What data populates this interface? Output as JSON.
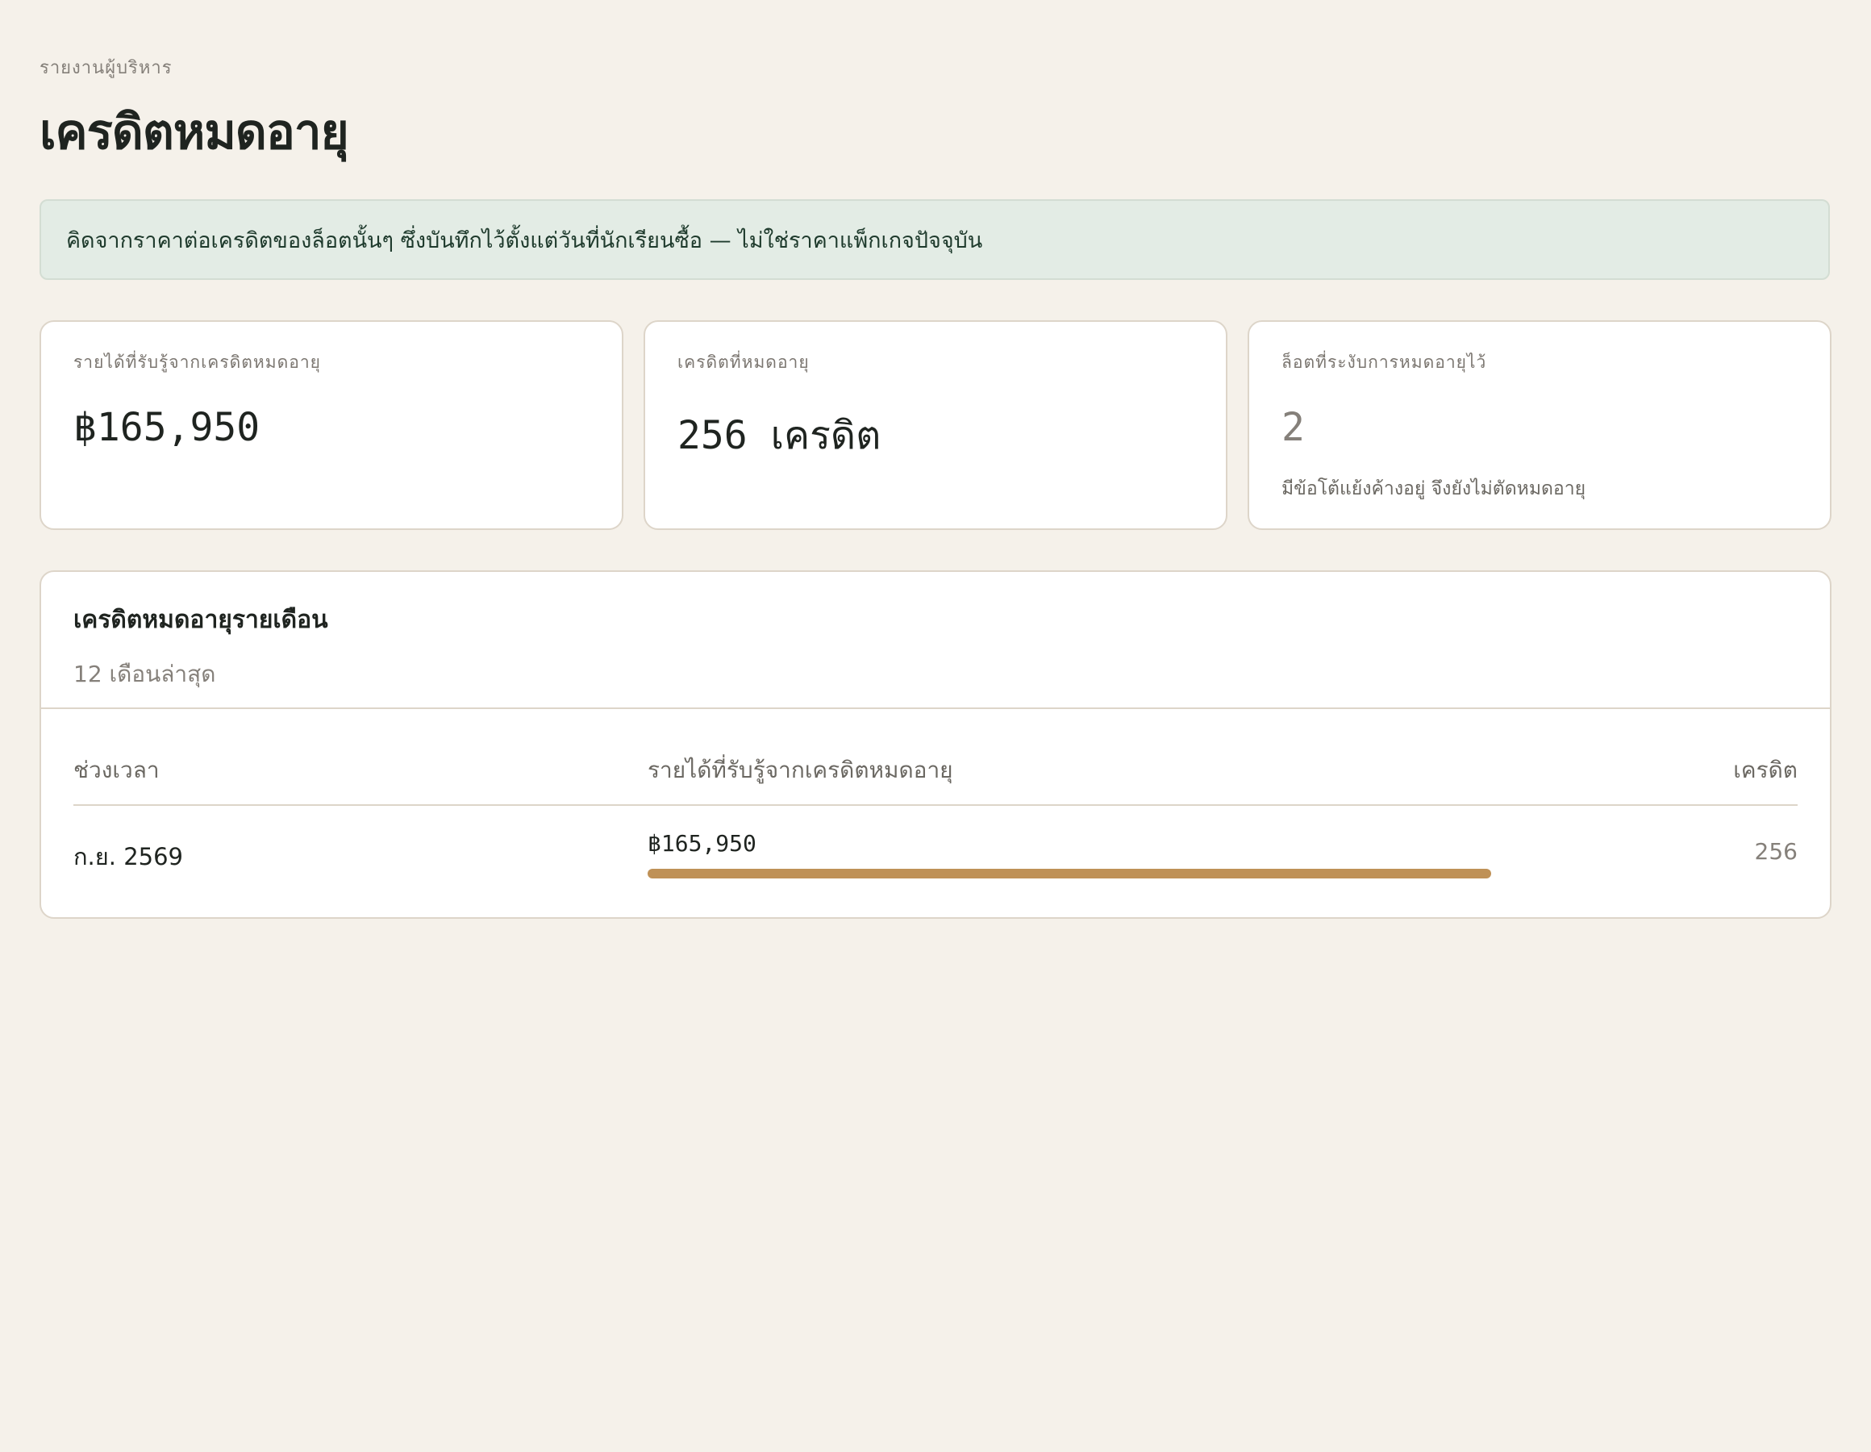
{
  "header": {
    "eyebrow": "รายงานผู้บริหาร",
    "title": "เครดิตหมดอายุ"
  },
  "notice": {
    "text": "คิดจากราคาต่อเครดิตของล็อตนั้นๆ ซึ่งบันทึกไว้ตั้งแต่วันที่นักเรียนซื้อ — ไม่ใช่ราคาแพ็กเกจปัจจุบัน"
  },
  "kpis": [
    {
      "label": "รายได้ที่รับรู้จากเครดิตหมดอายุ",
      "value": "฿165,950",
      "note": ""
    },
    {
      "label": "เครดิตที่หมดอายุ",
      "value": "256 เครดิต",
      "note": ""
    },
    {
      "label": "ล็อตที่ระงับการหมดอายุไว้",
      "value": "2",
      "note": "มีข้อโต้แย้งค้างอยู่ จึงยังไม่ตัดหมดอายุ"
    }
  ],
  "monthly": {
    "title": "เครดิตหมดอายุรายเดือน",
    "subtitle": "12 เดือนล่าสุด",
    "columns": {
      "period": "ช่วงเวลา",
      "revenue": "รายได้ที่รับรู้จากเครดิตหมดอายุ",
      "credits": "เครดิต"
    },
    "rows": [
      {
        "period": "ก.ย. 2569",
        "revenue": "฿165,950",
        "bar_fraction": 1.0,
        "credits": "256"
      }
    ]
  },
  "colors": {
    "background": "#f5f1ea",
    "notice_bg": "#e3ece5",
    "bar": "#bf9157"
  }
}
